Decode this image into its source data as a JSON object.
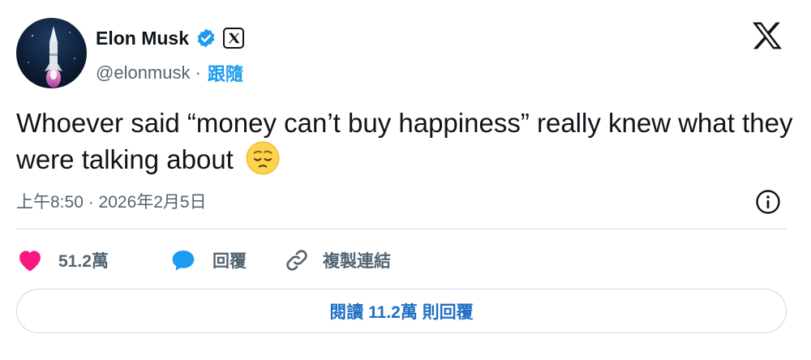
{
  "author": {
    "name": "Elon Musk",
    "handle": "@elonmusk",
    "separator": "·",
    "follow_label": "跟隨"
  },
  "tweet": {
    "text": "Whoever said “money can’t buy happiness” really knew what they were talking about",
    "emoji": "pensive-face",
    "timestamp": "上午8:50 · 2026年2月5日"
  },
  "actions": {
    "like_count": "51.2萬",
    "reply_label": "回覆",
    "copy_link_label": "複製連結"
  },
  "read_replies_label": "閱讀 11.2萬 則回覆",
  "colors": {
    "text": "#0f1419",
    "secondary": "#536471",
    "link_blue": "#1d9bf0",
    "like_pink": "#f91880",
    "verified_blue": "#1d9bf0"
  }
}
